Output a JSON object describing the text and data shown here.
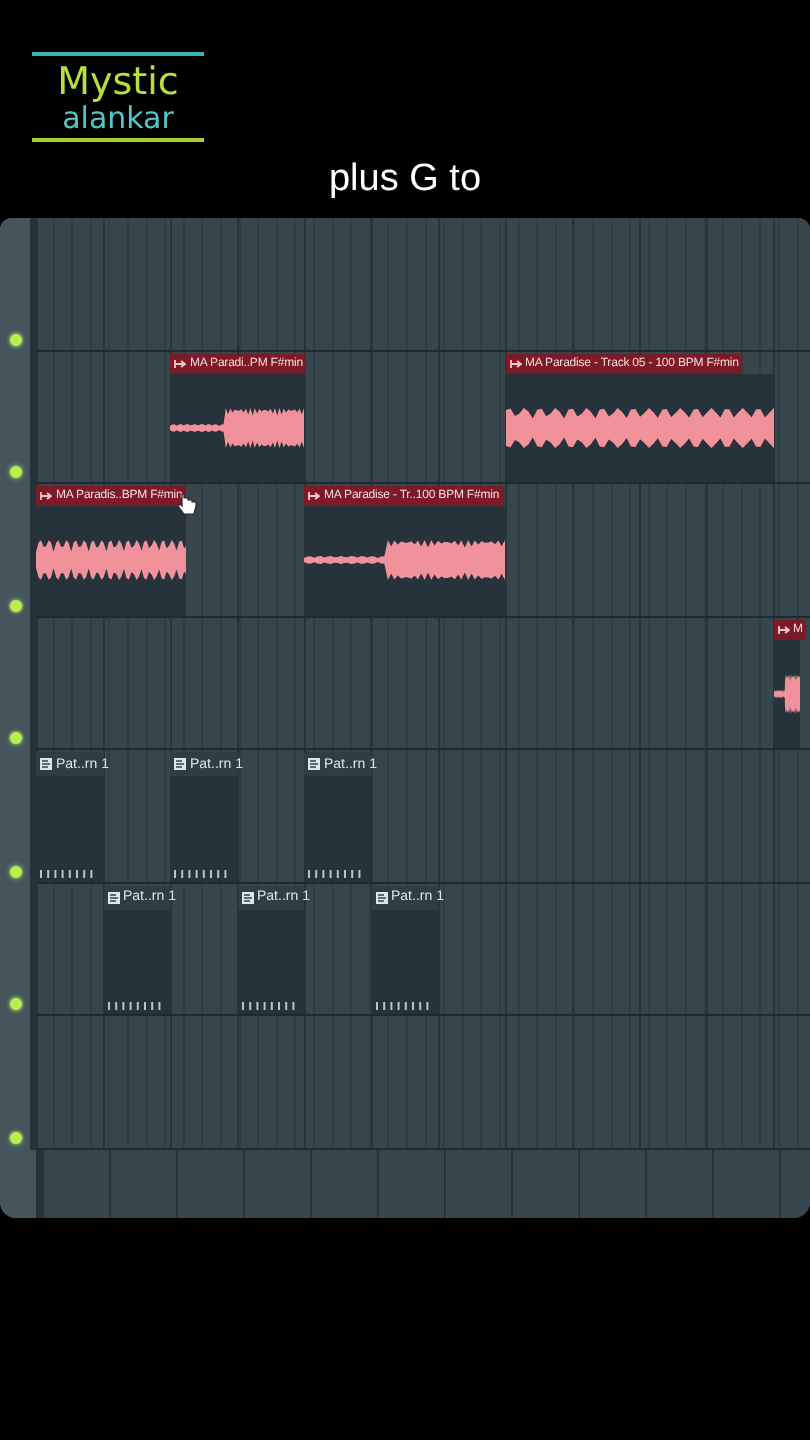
{
  "logo": {
    "line_1": "Mystic",
    "line_2": "alankar"
  },
  "caption": "plus G to",
  "playlist": {
    "tracks": [
      {
        "enabled": true
      },
      {
        "enabled": true,
        "clips": [
          {
            "kind": "audio",
            "label": "MA Paradi..PM F#min"
          },
          {
            "kind": "audio",
            "label": "MA Paradise - Track 05 - 100 BPM F#min"
          }
        ]
      },
      {
        "enabled": true,
        "clips": [
          {
            "kind": "audio",
            "label": "MA Paradis..BPM F#min"
          },
          {
            "kind": "audio",
            "label": "MA Paradise - Tr..100 BPM F#min"
          }
        ]
      },
      {
        "enabled": true,
        "clips": [
          {
            "kind": "audio",
            "label": "M"
          }
        ]
      },
      {
        "enabled": true,
        "clips": [
          {
            "kind": "pattern",
            "label": "Pat..rn 1"
          },
          {
            "kind": "pattern",
            "label": "Pat..rn 1"
          },
          {
            "kind": "pattern",
            "label": "Pat..rn 1"
          }
        ]
      },
      {
        "enabled": true,
        "clips": [
          {
            "kind": "pattern",
            "label": "Pat..rn 1"
          },
          {
            "kind": "pattern",
            "label": "Pat..rn 1"
          },
          {
            "kind": "pattern",
            "label": "Pat..rn 1"
          }
        ]
      },
      {
        "enabled": true
      }
    ]
  }
}
